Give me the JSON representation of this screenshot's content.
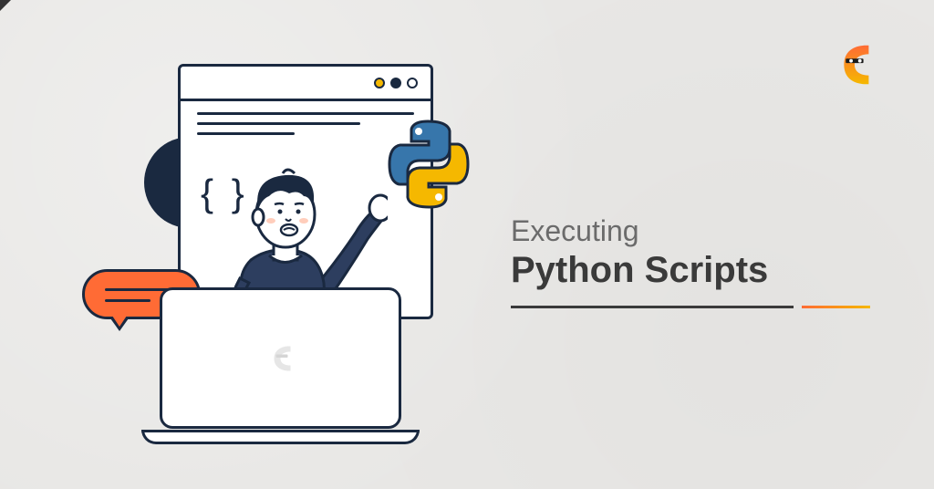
{
  "title": {
    "line1": "Executing",
    "line2": "Python Scripts"
  },
  "illustration": {
    "braces": "{ }",
    "python_logo": "python-logo",
    "speech_bubble": "speech-bubble",
    "laptop_logo": "coding-ninjas-icon"
  },
  "brand": {
    "logo": "coding-ninjas-logo",
    "primary_color": "#ff6b35",
    "secondary_color": "#f5b800",
    "dark_color": "#1a2940"
  }
}
